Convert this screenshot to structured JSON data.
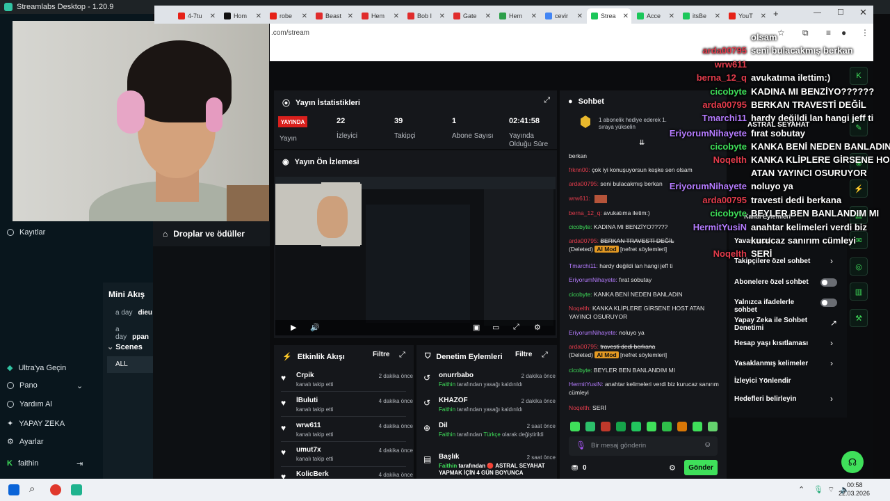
{
  "streamlabs": {
    "title": "Streamlabs Desktop - 1.20.9",
    "nav": [
      {
        "label": "Kayıtlar"
      },
      {
        "label": "Ultra'ya Geçin"
      },
      {
        "label": "Pano"
      },
      {
        "label": "Yardım Al"
      },
      {
        "label": "YAPAY ZEKA"
      },
      {
        "label": "Ayarlar"
      },
      {
        "label": "faithin"
      }
    ],
    "mini_aku": {
      "title": "Mini Akış",
      "rows": [
        {
          "time": "a day",
          "name": "dieu"
        },
        {
          "time": "a day",
          "name": "ppan"
        }
      ],
      "scenes_label": "Scenes",
      "all_label": "ALL"
    },
    "droplar_label": "Droplar ve ödüller"
  },
  "browser": {
    "tabs": [
      {
        "label": "4-7tu",
        "color": "#e62117"
      },
      {
        "label": "Hom",
        "color": "#111111"
      },
      {
        "label": "robe",
        "color": "#e62117"
      },
      {
        "label": "Beast",
        "color": "#e02c2c"
      },
      {
        "label": "Hem",
        "color": "#e02c2c"
      },
      {
        "label": "Bob I",
        "color": "#e02c2c"
      },
      {
        "label": "Gate",
        "color": "#e02c2c"
      },
      {
        "label": "Hem",
        "color": "#2d9f4a"
      },
      {
        "label": "cevir",
        "color": "#4285f4"
      },
      {
        "label": "Strea",
        "color": "#1cc75a"
      },
      {
        "label": "Acce",
        "color": "#1cc75a"
      },
      {
        "label": "itsBe",
        "color": "#1cc75a"
      },
      {
        "label": "YouT",
        "color": "#e62117"
      }
    ],
    "url": ".com/stream"
  },
  "stats": {
    "title": "Yayın İstatistikleri",
    "live_badge": "YAYINDA",
    "live_label": "Yayın",
    "viewers_value": "22",
    "viewers_label": "İzleyici",
    "followers_value": "39",
    "followers_label": "Takipçi",
    "subs_value": "1",
    "subs_label": "Abone Sayısı",
    "uptime_value": "02:41:58",
    "uptime_label": "Yayında Olduğu Süre"
  },
  "preview_title": "Yayın Ön İzlemesi",
  "activity": {
    "title": "Etkinlik Akışı",
    "filter": "Filtre",
    "items": [
      {
        "name": "Crpik",
        "sub": "kanalı takip etti",
        "time": "2 dakika önce"
      },
      {
        "name": "lBuluti",
        "sub": "kanalı takip etti",
        "time": "4 dakika önce"
      },
      {
        "name": "wrw611",
        "sub": "kanalı takip etti",
        "time": "4 dakika önce"
      },
      {
        "name": "umut7x",
        "sub": "kanalı takip etti",
        "time": "4 dakika önce"
      },
      {
        "name": "KolicBerk",
        "sub": "",
        "time": "4 dakika önce"
      }
    ]
  },
  "moderation": {
    "title": "Denetim Eylemleri",
    "filter": "Filtre",
    "items": [
      {
        "name": "onurrbabo",
        "actor": "Faithin",
        "text": "tarafından yasağı kaldırıldı",
        "time": "2 dakika önce"
      },
      {
        "name": "KHAZOF",
        "actor": "Faithin",
        "text": "tarafından yasağı kaldırıldı",
        "time": "2 dakika önce"
      },
      {
        "name": "Dil",
        "actor": "Faithin",
        "text": "tarafından",
        "lang": "Türkçe",
        "text2": "olarak değiştirildi",
        "time": "2 saat önce"
      },
      {
        "name": "Başlık",
        "actor": "Faithin",
        "text": "tarafından 🔴 ASTRAL SEYAHAT YAPMAK İÇİN 4 GÜN BOYUNCA",
        "time": "2 saat önce"
      }
    ]
  },
  "chat": {
    "title": "Sohbet",
    "pinned": "1 abonelik hediye ederek 1. sıraya yükselin",
    "lines": [
      {
        "user": "",
        "msg": "berkan",
        "color": "u-green"
      },
      {
        "user": "frknn00:",
        "msg": "çok iyi konuşuyorsun keşke sen olsam",
        "color": "u-red"
      },
      {
        "user": "arda00795:",
        "msg": "seni bulacakmış berkan",
        "color": "u-red"
      },
      {
        "user": "wrw611:",
        "msg": "",
        "color": "u-red"
      },
      {
        "user": "berna_12_q:",
        "msg": "avukatıma iletim:)",
        "color": "u-red"
      },
      {
        "user": "cicobyte:",
        "msg": "KADINA MI BENZİYO?????",
        "color": "u-green"
      },
      {
        "user": "arda00795:",
        "msg": "BERKAN TRAVESTİ DEĞİL",
        "color": "u-red"
      },
      {
        "user": "Tmarchi11:",
        "msg": "hardy değildi lan hangi jeff ti",
        "color": "u-purple"
      },
      {
        "user": "EriyorumNihayete:",
        "msg": "fırat sobutay",
        "color": "u-purple"
      },
      {
        "user": "cicobyte:",
        "msg": "KANKA BENİ NEDEN BANLADIN",
        "color": "u-green"
      },
      {
        "user": "Noqelth:",
        "msg": "KANKA KLİPLERE GİRSENE HOST ATAN YAYINCI OSURUYOR",
        "color": "u-red"
      },
      {
        "user": "EriyorumNihayete:",
        "msg": "noluyo ya",
        "color": "u-purple"
      },
      {
        "user": "arda00795:",
        "msg": "travesti dedi berkana",
        "color": "u-red"
      },
      {
        "user": "cicobyte:",
        "msg": "BEYLER BEN BANLANDIM MI",
        "color": "u-green"
      },
      {
        "user": "HermitYusiN:",
        "msg": "anahtar kelimeleri verdi biz kurucaz sanırım cümleyi",
        "color": "u-purple"
      },
      {
        "user": "Noqelth:",
        "msg": "SERİ",
        "color": "u-red"
      }
    ],
    "deleted": "(Deleted)",
    "ai_mod": "AI Mod",
    "hate_tag": "[nefret söylemleri]",
    "input_placeholder": "Bir mesaj gönderin",
    "points": "0",
    "send": "Gönder"
  },
  "overlay": {
    "top_lines": [
      {
        "name": "",
        "msg": "olsam"
      },
      {
        "name": "arda00795",
        "msg": "seni bulacakmış berkan"
      },
      {
        "name": "wrw611",
        "msg": ""
      },
      {
        "name": "berna_12_q",
        "msg": "avukatıma ilettim:)"
      },
      {
        "name": "cicobyte",
        "msg": "KADINA MI BENZİYO??????"
      },
      {
        "name": "arda00795",
        "msg": "BERKAN TRAVESTİ DEĞİL"
      },
      {
        "name": "Tmarchi11",
        "msg": "hardy değildi lan hangi jeff ti"
      },
      {
        "name": "",
        "msg": "ASTRAL SEYAHAT"
      },
      {
        "name": "EriyorumNihayete",
        "msg": "fırat sobutay"
      },
      {
        "name": "cicobyte",
        "msg": "KANKA BENİ NEDEN BANLADIN"
      },
      {
        "name": "Noqelth",
        "msg": "KANKA KLİPLERE GİRSENE HOST"
      },
      {
        "name": "",
        "msg": "ATAN YAYINCI OSURUYOR"
      },
      {
        "name": "EriyorumNihayete",
        "msg": "noluyo ya"
      },
      {
        "name": "arda00795",
        "msg": "travesti dedi berkana"
      },
      {
        "name": "cicobyte",
        "msg": "BEYLER BEN BANLANDIM MI"
      },
      {
        "name": "HermitYusiN",
        "msg": "anahtar kelimeleri verdi biz"
      },
      {
        "name": "",
        "msg": "kurucaz sanırım cümleyi"
      },
      {
        "name": "Noqelth",
        "msg": "SERİ"
      }
    ]
  },
  "settings_menu": {
    "title": "Kanal Eylemleri",
    "items": [
      {
        "label": "Yavaş mod",
        "kind": "chevron"
      },
      {
        "label": "Takipçilere özel sohbet",
        "kind": "chevron"
      },
      {
        "label": "Abonelere özel sohbet",
        "kind": "toggle"
      },
      {
        "label": "Yalnızca ifadelerle sohbet",
        "kind": "toggle"
      },
      {
        "label": "Yapay Zeka ile Sohbet Denetimi",
        "kind": "external"
      },
      {
        "label": "Hesap yaşı kısıtlaması",
        "kind": "chevron"
      },
      {
        "label": "Yasaklanmış kelimeler",
        "kind": "chevron"
      },
      {
        "label": "İzleyici Yönlendir",
        "kind": "none"
      },
      {
        "label": "Hedefleri belirleyin",
        "kind": "chevron"
      }
    ]
  },
  "taskbar": {
    "time": "00:58",
    "date": "22.03.2026"
  },
  "colors": {
    "accent_green": "#3fe05a",
    "live_red": "#d9201d",
    "name_red": "#e43c4c",
    "name_green": "#3fe05a",
    "name_purple": "#b57cff"
  }
}
